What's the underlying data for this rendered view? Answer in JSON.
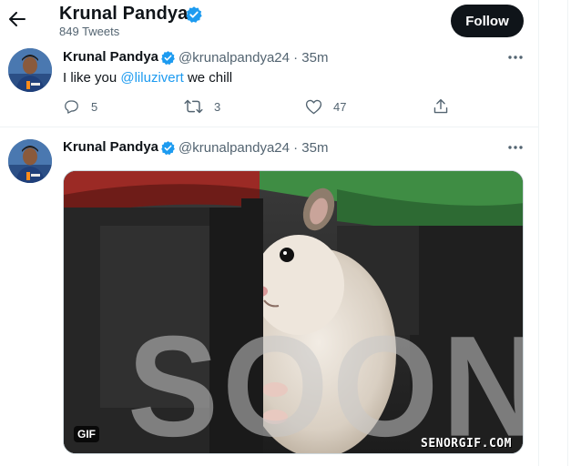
{
  "header": {
    "name": "Krunal Pandya",
    "tweet_count": "849 Tweets",
    "follow_label": "Follow"
  },
  "tweets": [
    {
      "name": "Krunal Pandya",
      "handle_time": "@krunalpandya24 · 35m",
      "text_before": "I like you ",
      "mention": "@liluzivert",
      "text_after": " we chill",
      "reply_count": "5",
      "retweet_count": "3",
      "like_count": "47"
    },
    {
      "name": "Krunal Pandya",
      "handle_time": "@krunalpandya24 · 35m",
      "media": {
        "badge": "GIF",
        "overlay_text": "SOON",
        "watermark": "SENORGIF.COM"
      }
    }
  ],
  "colors": {
    "accent": "#1d9bf0",
    "verified": "#1d9bf0",
    "text_primary": "#0f1419",
    "text_secondary": "#536471"
  },
  "icons": [
    "back-arrow-icon",
    "verified-icon",
    "more-icon",
    "reply-icon",
    "retweet-icon",
    "like-icon",
    "share-icon"
  ]
}
